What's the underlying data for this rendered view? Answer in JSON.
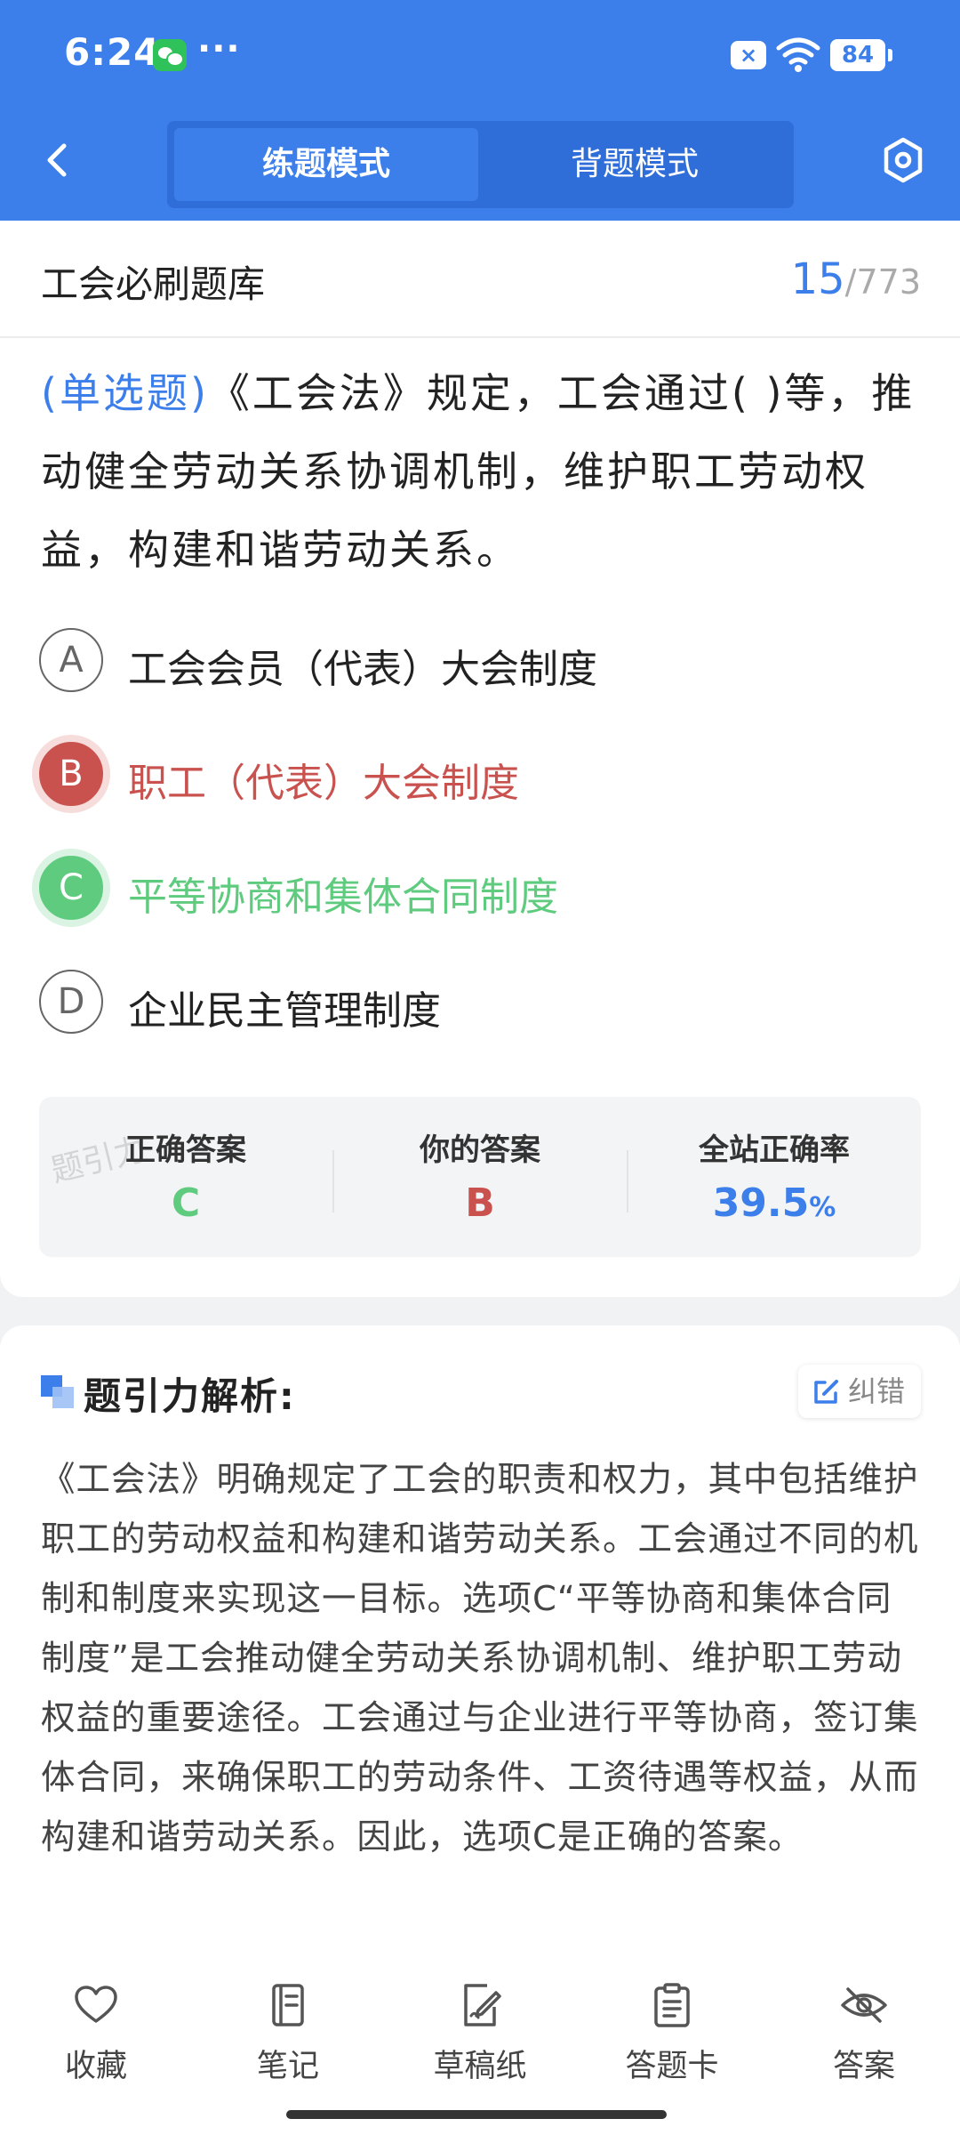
{
  "status_bar": {
    "time": "6:24",
    "more": "···",
    "battery": "84"
  },
  "nav": {
    "modes": [
      "练题模式",
      "背题模式"
    ],
    "active_mode_index": 0
  },
  "bank": {
    "title": "工会必刷题库",
    "current": "15",
    "separator": "/",
    "total": "773"
  },
  "question": {
    "type_label": "(单选题)",
    "text": "《工会法》规定，工会通过( )等，推动健全劳动关系协调机制，维护职工劳动权益，构建和谐劳动关系。"
  },
  "options": [
    {
      "letter": "A",
      "text": "工会会员（代表）大会制度",
      "state": "neutral"
    },
    {
      "letter": "B",
      "text": "职工（代表）大会制度",
      "state": "wrong"
    },
    {
      "letter": "C",
      "text": "平等协商和集体合同制度",
      "state": "right"
    },
    {
      "letter": "D",
      "text": "企业民主管理制度",
      "state": "neutral"
    }
  ],
  "result": {
    "correct_label": "正确答案",
    "correct_value": "C",
    "yours_label": "你的答案",
    "yours_value": "B",
    "rate_label": "全站正确率",
    "rate_value": "39.5",
    "rate_unit": "%",
    "watermark": "题引力"
  },
  "analysis": {
    "title": "题引力解析:",
    "correction_label": "纠错",
    "body": "《工会法》明确规定了工会的职责和权力，其中包括维护职工的劳动权益和构建和谐劳动关系。工会通过不同的机制和制度来实现这一目标。选项C“平等协商和集体合同制度”是工会推动健全劳动关系协调机制、维护职工劳动权益的重要途径。工会通过与企业进行平等协商，签订集体合同，来确保职工的劳动条件、工资待遇等权益，从而构建和谐劳动关系。因此，选项C是正确的答案。"
  },
  "bottom_tabs": [
    {
      "label": "收藏",
      "icon": "heart-icon"
    },
    {
      "label": "笔记",
      "icon": "notebook-icon"
    },
    {
      "label": "草稿纸",
      "icon": "draft-pen-icon"
    },
    {
      "label": "答题卡",
      "icon": "clipboard-icon"
    },
    {
      "label": "答案",
      "icon": "eye-off-icon"
    }
  ],
  "colors": {
    "accent": "#3c7eea",
    "wrong": "#c9524f",
    "right": "#5fcb7e"
  }
}
